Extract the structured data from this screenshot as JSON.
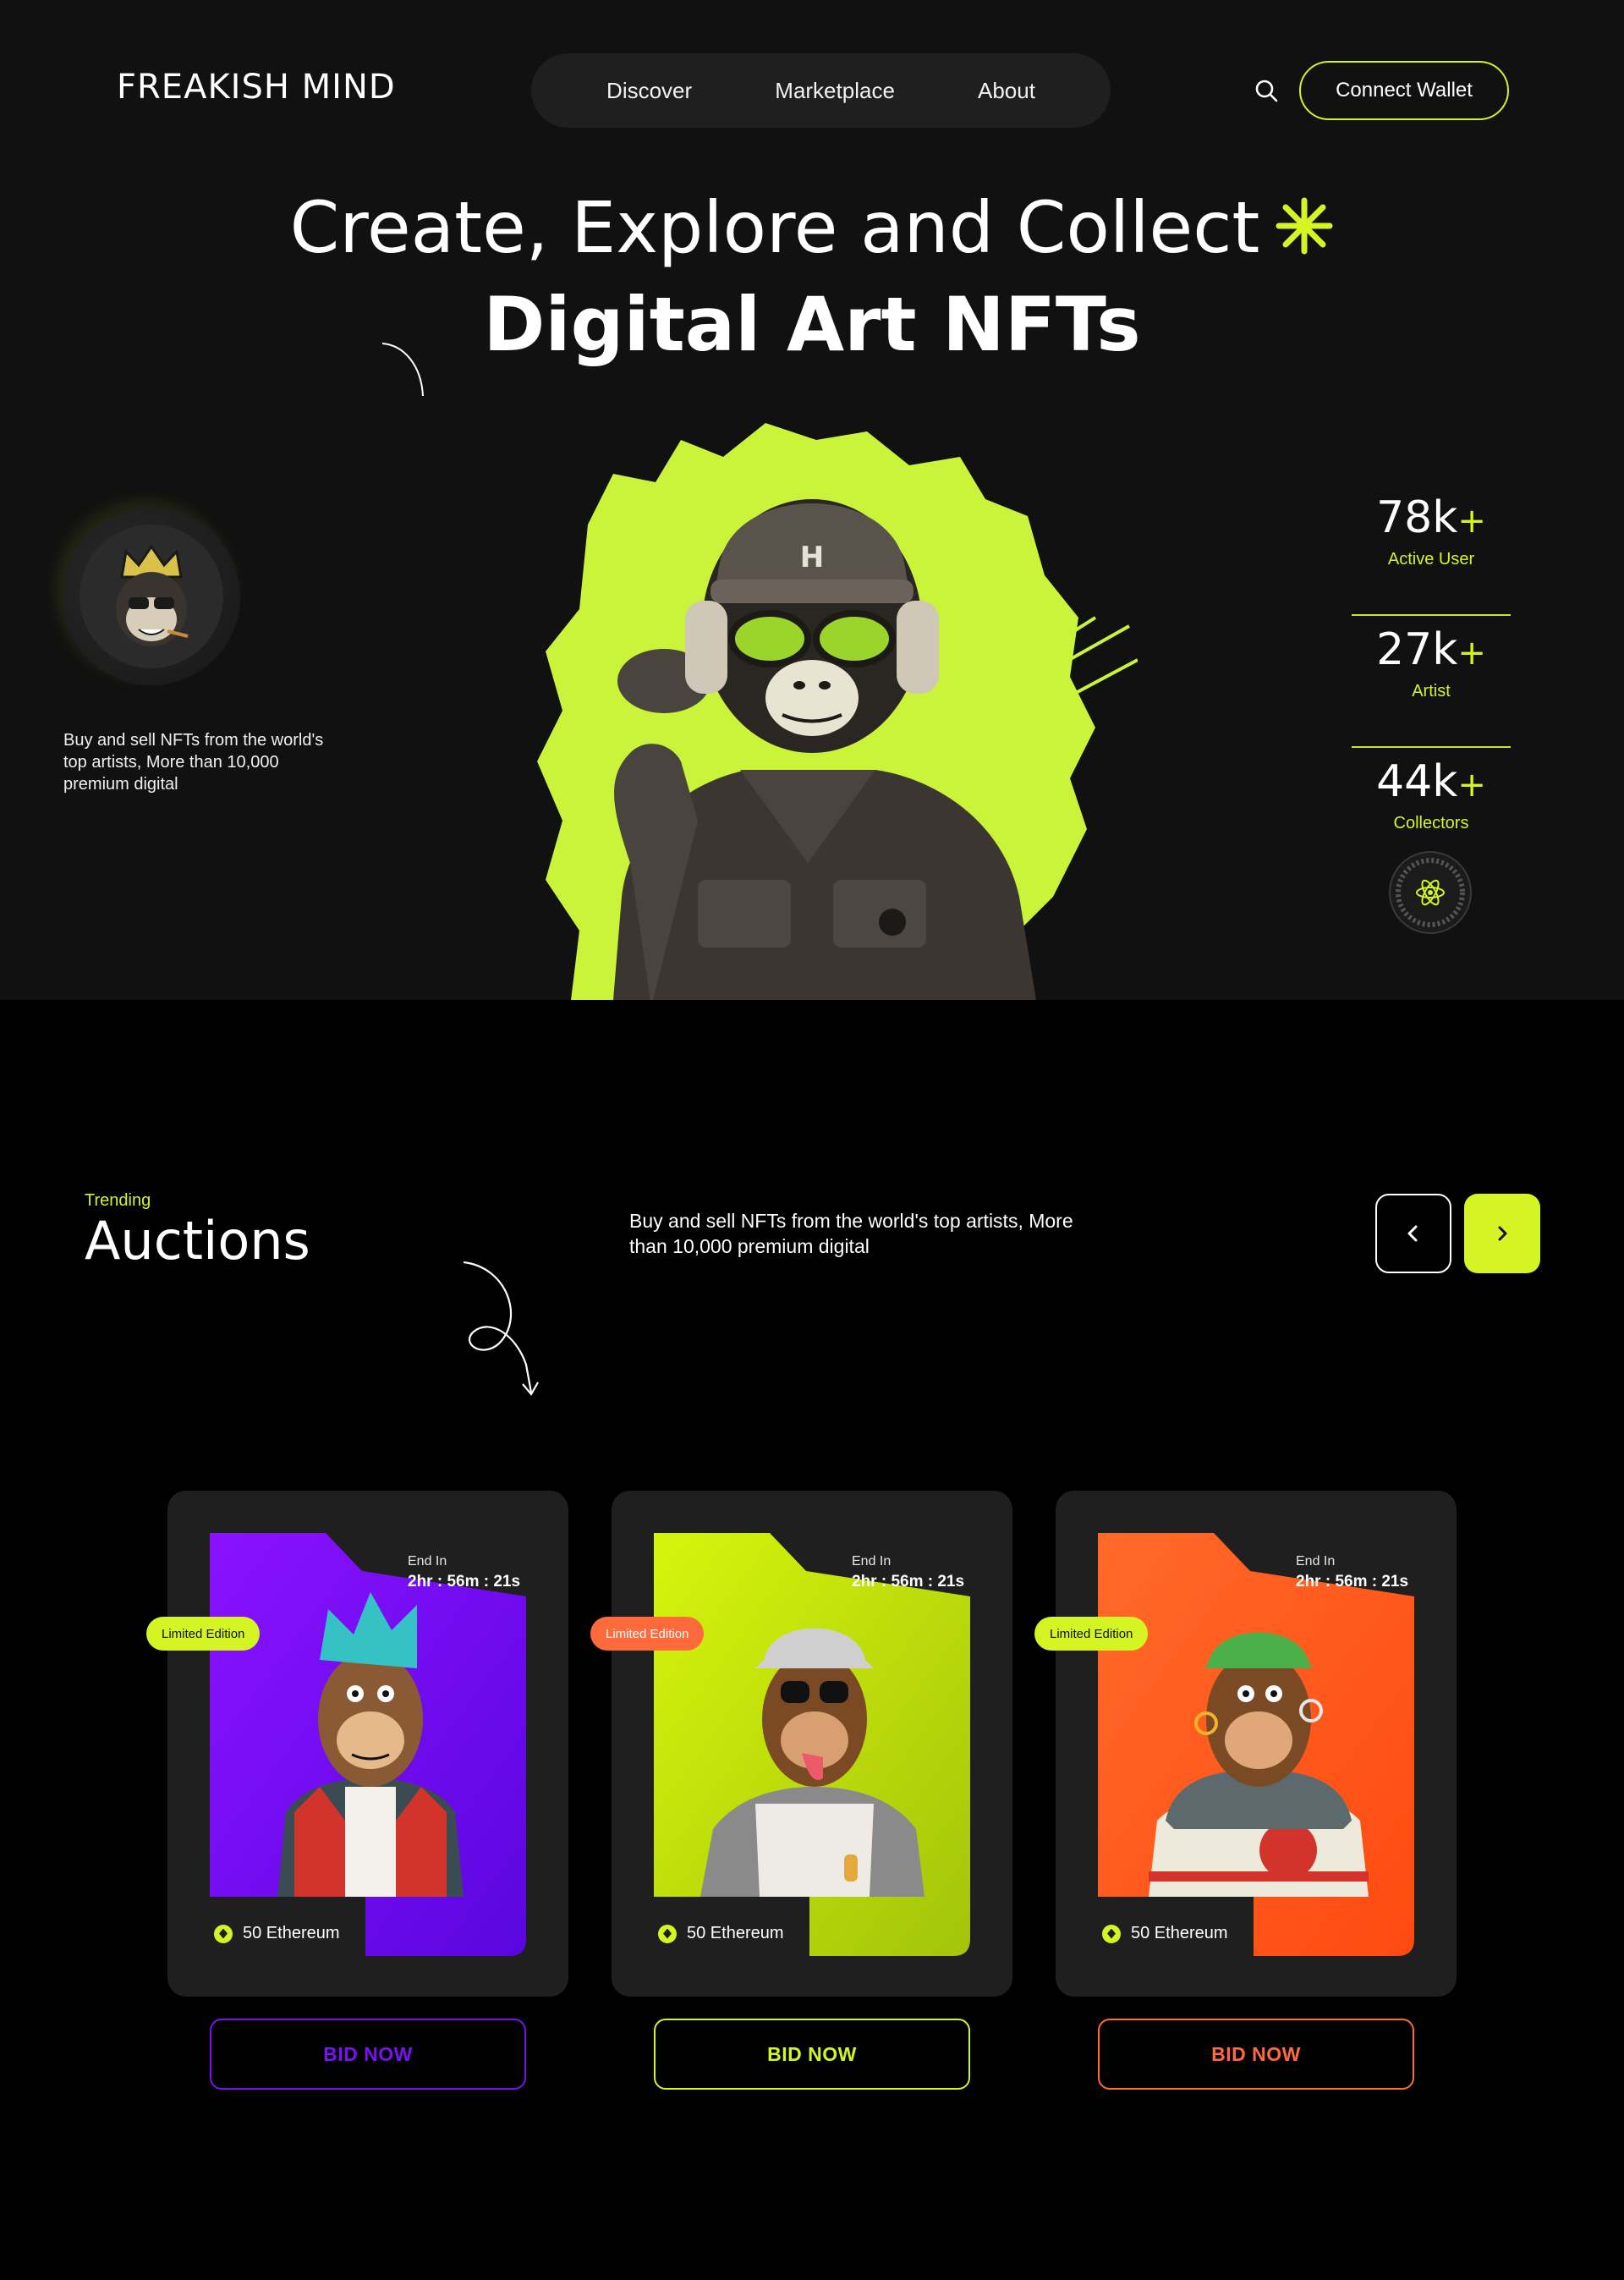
{
  "brand": {
    "logo": "FREAKISH MIND",
    "accent": "#d4f523"
  },
  "nav": {
    "items": [
      "Discover",
      "Marketplace",
      "About"
    ]
  },
  "header": {
    "search_icon": "search-icon",
    "connect_label": "Connect Wallet"
  },
  "hero": {
    "title_line1": "Create, Explore and Collect",
    "title_line2": "Digital Art NFTs",
    "description": "Buy and sell NFTs from the world's top artists, More than 10,000 premium digital",
    "stats": [
      {
        "value": "78k",
        "plus": "+",
        "label": "Active User"
      },
      {
        "value": "27k",
        "plus": "+",
        "label": "Artist"
      },
      {
        "value": "44k",
        "plus": "+",
        "label": "Collectors"
      }
    ]
  },
  "auctions": {
    "eyebrow": "Trending",
    "title": "Auctions",
    "description": "Buy and sell NFTs from the world's top artists, More than 10,000 premium digital",
    "cards": [
      {
        "badge": "Limited Edition",
        "badge_color": "#d4f523",
        "end_label": "End In",
        "time": "2hr : 56m : 21s",
        "price": "50 Ethereum",
        "bid": "BID NOW",
        "color": "#7a12f0",
        "bid_color": "#7a12f0"
      },
      {
        "badge": "Limited Edition",
        "badge_color": "#ff6a3d",
        "end_label": "End In",
        "time": "2hr : 56m : 21s",
        "price": "50 Ethereum",
        "bid": "BID NOW",
        "color": "#c8ef10",
        "bid_color": "#d4f523"
      },
      {
        "badge": "Limited Edition",
        "badge_color": "#d4f523",
        "end_label": "End In",
        "time": "2hr : 56m : 21s",
        "price": "50 Ethereum",
        "bid": "BID NOW",
        "color": "#ff5a1f",
        "bid_color": "#ff6a3d"
      }
    ]
  }
}
